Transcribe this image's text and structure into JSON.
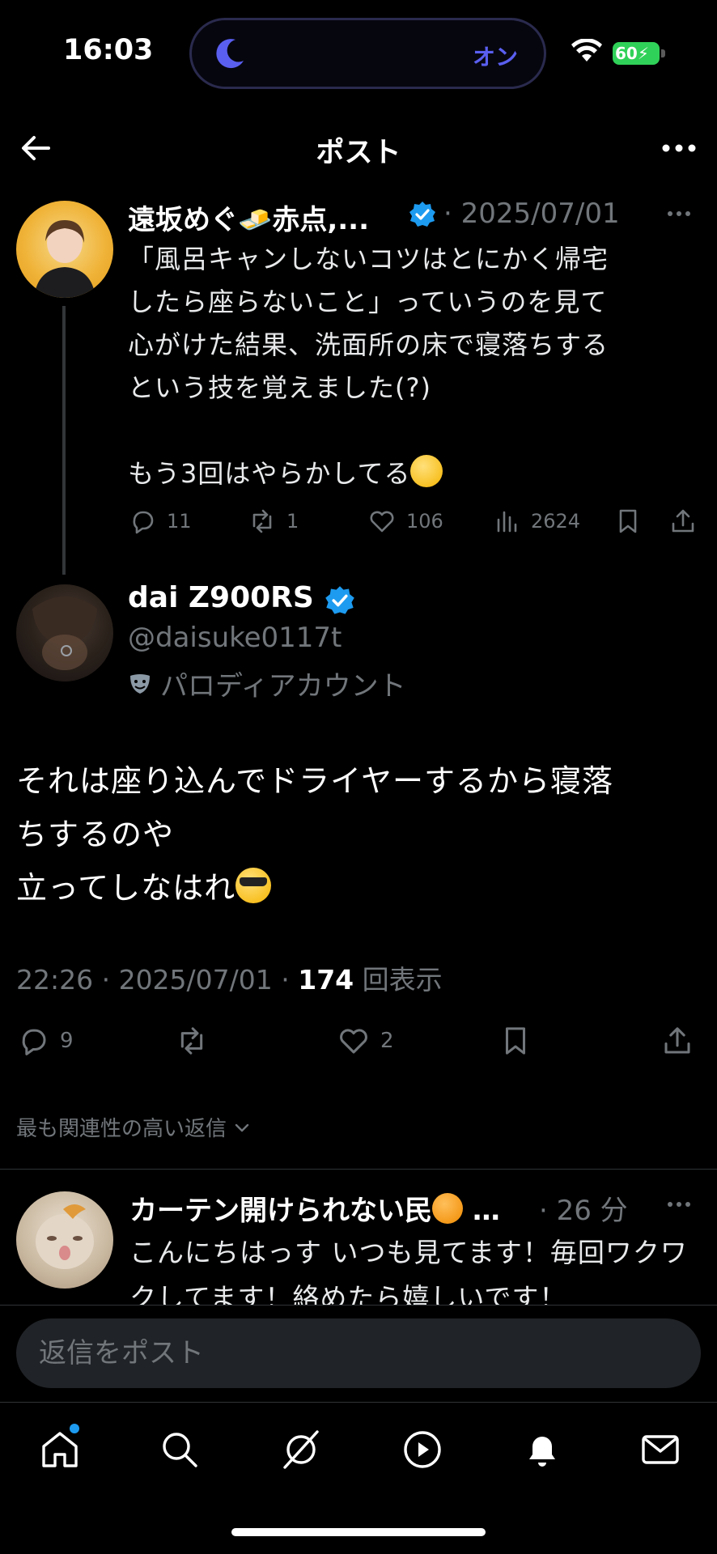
{
  "status_bar": {
    "time": "16:03",
    "focus_mode_label": "オン",
    "battery": "60"
  },
  "header": {
    "title": "ポスト",
    "back_icon": "arrow-left-icon",
    "more_icon": "more-horizontal-icon"
  },
  "parent_post": {
    "author_name": "遠坂めぐ🧈赤点,...",
    "date": "· 2025/07/01",
    "text_lines": [
      "「風呂キャンしないコツはとにかく帰宅",
      "したら座らないこと」っていうのを見て",
      "心がけた結果、洗面所の床で寝落ちする",
      "という技を覚えました(?)",
      "",
      "もう3回はやらかしてる"
    ],
    "replies": "11",
    "reposts": "1",
    "likes": "106",
    "views": "2624"
  },
  "main_post": {
    "author_name": "dai Z900RS",
    "handle": "@daisuke0117t",
    "parody_label": "パロディアカウント",
    "text_lines": [
      "それは座り込んでドライヤーするから寝落",
      "ちするのや",
      "立ってしなはれ"
    ],
    "time": "22:26 · 2025/07/01 · ",
    "view_count": "174",
    "view_label": " 回表示",
    "replies": "9",
    "likes": "2"
  },
  "relevance_label": "最も関連性の高い返信",
  "reply_preview": {
    "author_name": "カーテン開けられない民",
    "author_suffix": " …",
    "time": "· 26 分",
    "text": "こんにちはっす いつも見てます！毎回ワクワクしてます！絡めたら嬉しいです！"
  },
  "reply_input": {
    "placeholder": "返信をポスト"
  },
  "tab_bar": {
    "items": [
      "home-icon",
      "search-icon",
      "grok-icon",
      "video-icon",
      "notifications-icon",
      "messages-icon"
    ]
  },
  "colors": {
    "accent": "#1d9bf0",
    "background": "#000000",
    "secondary_text": "#71767b",
    "focus_purple": "#5a5ff0",
    "battery_green": "#30d158"
  }
}
